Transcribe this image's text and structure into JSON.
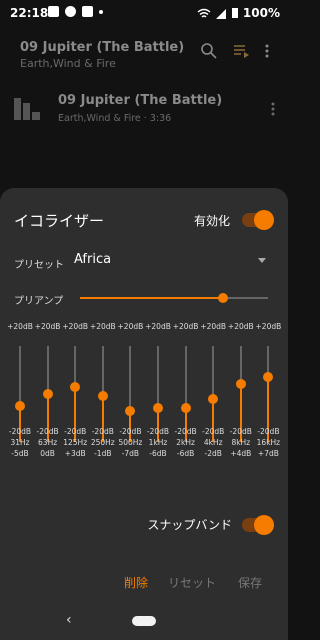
{
  "status": {
    "time": "22:18",
    "battery": "100%"
  },
  "now_playing": {
    "title": "09 Jupiter (The Battle)",
    "artist": "Earth,Wind & Fire"
  },
  "track": {
    "title": "09 Jupiter (The Battle)",
    "meta": "Earth,Wind & Fire · 3:36"
  },
  "eq": {
    "title": "イコライザー",
    "enable_label": "有効化",
    "preset_label": "プリセット",
    "preset_value": "Africa",
    "preamp_label": "プリアンプ",
    "preamp_level": 0.76,
    "accent": "#f57c00",
    "bands": [
      {
        "max": "+20dB",
        "min": "-20dB",
        "freq": "31Hz",
        "gain": "-5dB",
        "value": -5
      },
      {
        "max": "+20dB",
        "min": "-20dB",
        "freq": "63Hz",
        "gain": "0dB",
        "value": 0
      },
      {
        "max": "+20dB",
        "min": "-20dB",
        "freq": "125Hz",
        "gain": "+3dB",
        "value": 3
      },
      {
        "max": "+20dB",
        "min": "-20dB",
        "freq": "250Hz",
        "gain": "-1dB",
        "value": -1
      },
      {
        "max": "+20dB",
        "min": "-20dB",
        "freq": "500Hz",
        "gain": "-7dB",
        "value": -7
      },
      {
        "max": "+20dB",
        "min": "-20dB",
        "freq": "1kHz",
        "gain": "-6dB",
        "value": -6
      },
      {
        "max": "+20dB",
        "min": "-20dB",
        "freq": "2kHz",
        "gain": "-6dB",
        "value": -6
      },
      {
        "max": "+20dB",
        "min": "-20dB",
        "freq": "4kHz",
        "gain": "-2dB",
        "value": -2
      },
      {
        "max": "+20dB",
        "min": "-20dB",
        "freq": "8kHz",
        "gain": "+4dB",
        "value": 4
      },
      {
        "max": "+20dB",
        "min": "-20dB",
        "freq": "16kHz",
        "gain": "+7dB",
        "value": 7
      }
    ],
    "snap_label": "スナップバンド",
    "delete_label": "削除",
    "reset_label": "リセット",
    "save_label": "保存"
  }
}
